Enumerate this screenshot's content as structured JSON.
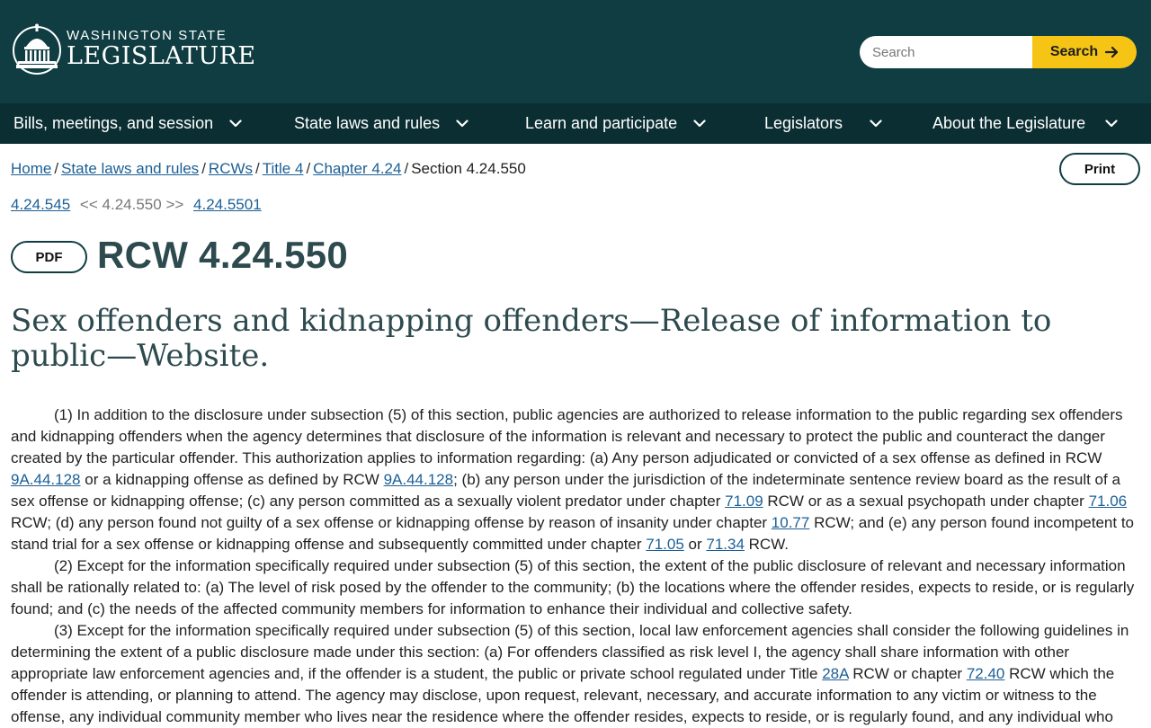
{
  "header": {
    "logo_line1": "WASHINGTON STATE",
    "logo_line2": "LEGISLATURE",
    "search_placeholder": "Search",
    "search_button": "Search",
    "colors": {
      "header_bg": "#0f3d42",
      "nav_bg": "#0b2e33",
      "accent": "#f6c414",
      "link": "#1b5f96"
    }
  },
  "nav": {
    "items": [
      {
        "label": "Bills, meetings, and session"
      },
      {
        "label": "State laws and rules"
      },
      {
        "label": "Learn and participate"
      },
      {
        "label": "Legislators"
      },
      {
        "label": "About the Legislature"
      }
    ]
  },
  "breadcrumb": {
    "items": [
      "Home",
      "State laws and rules",
      "RCWs",
      "Title 4",
      "Chapter 4.24"
    ],
    "current": "Section 4.24.550"
  },
  "print_label": "Print",
  "seqnav": {
    "prev": "4.24.545",
    "current": "4.24.550",
    "next": "4.24.5501",
    "prev_arrows": "<<",
    "next_arrows": ">>"
  },
  "pdf_label": "PDF",
  "rcw_title": "RCW 4.24.550",
  "section_title": "Sex offenders and kidnapping offenders—Release of information to public—Website.",
  "body": {
    "p1": [
      "(1) In addition to the disclosure under subsection (5) of this section, public agencies are authorized to release information to the public regarding sex offenders and kidnapping offenders when the agency determines that disclosure of the information is relevant and necessary to protect the public and counteract the danger created by the particular offender. This authorization applies to information regarding: (a) Any person adjudicated or convicted of a sex offense as defined in RCW ",
      "9A.44.128",
      " or a kidnapping offense as defined by RCW ",
      "9A.44.128",
      "; (b) any person under the jurisdiction of the indeterminate sentence review board as the result of a sex offense or kidnapping offense; (c) any person committed as a sexually violent predator under chapter ",
      "71.09",
      " RCW or as a sexual psychopath under chapter ",
      "71.06",
      " RCW; (d) any person found not guilty of a sex offense or kidnapping offense by reason of insanity under chapter ",
      "10.77",
      " RCW; and (e) any person found incompetent to stand trial for a sex offense or kidnapping offense and subsequently committed under chapter ",
      "71.05",
      " or ",
      "71.34",
      " RCW."
    ],
    "p2": "(2) Except for the information specifically required under subsection (5) of this section, the extent of the public disclosure of relevant and necessary information shall be rationally related to: (a) The level of risk posed by the offender to the community; (b) the locations where the offender resides, expects to reside, or is regularly found; and (c) the needs of the affected community members for information to enhance their individual and collective safety.",
    "p3": [
      "(3) Except for the information specifically required under subsection (5) of this section, local law enforcement agencies shall consider the following guidelines in determining the extent of a public disclosure made under this section: (a) For offenders classified as risk level I, the agency shall share information with other appropriate law enforcement agencies and, if the offender is a student, the public or private school regulated under Title ",
      "28A",
      " RCW or chapter ",
      "72.40",
      " RCW which the offender is attending, or planning to attend. The agency may disclose, upon request, relevant, necessary, and accurate information to any victim or witness to the offense, any individual community member who lives near the residence where the offender resides, expects to reside, or is regularly found, and any individual who"
    ]
  }
}
